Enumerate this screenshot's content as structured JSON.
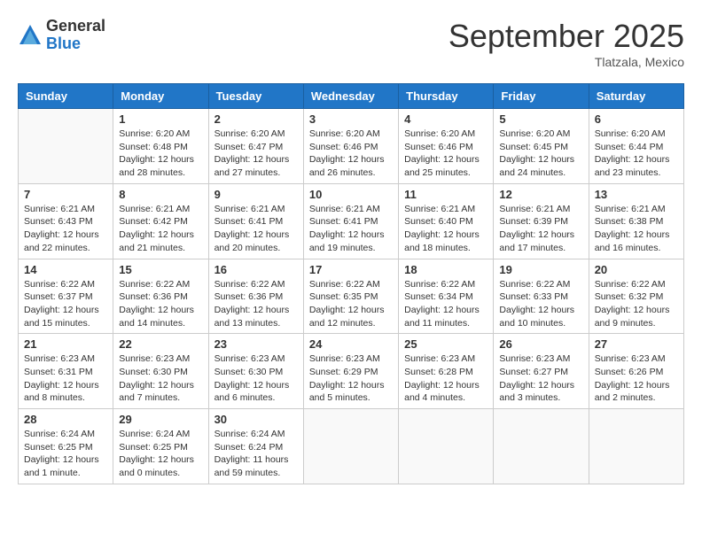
{
  "logo": {
    "general": "General",
    "blue": "Blue"
  },
  "header": {
    "month": "September 2025",
    "location": "Tlatzala, Mexico"
  },
  "weekdays": [
    "Sunday",
    "Monday",
    "Tuesday",
    "Wednesday",
    "Thursday",
    "Friday",
    "Saturday"
  ],
  "weeks": [
    [
      {
        "day": "",
        "info": ""
      },
      {
        "day": "1",
        "info": "Sunrise: 6:20 AM\nSunset: 6:48 PM\nDaylight: 12 hours\nand 28 minutes."
      },
      {
        "day": "2",
        "info": "Sunrise: 6:20 AM\nSunset: 6:47 PM\nDaylight: 12 hours\nand 27 minutes."
      },
      {
        "day": "3",
        "info": "Sunrise: 6:20 AM\nSunset: 6:46 PM\nDaylight: 12 hours\nand 26 minutes."
      },
      {
        "day": "4",
        "info": "Sunrise: 6:20 AM\nSunset: 6:46 PM\nDaylight: 12 hours\nand 25 minutes."
      },
      {
        "day": "5",
        "info": "Sunrise: 6:20 AM\nSunset: 6:45 PM\nDaylight: 12 hours\nand 24 minutes."
      },
      {
        "day": "6",
        "info": "Sunrise: 6:20 AM\nSunset: 6:44 PM\nDaylight: 12 hours\nand 23 minutes."
      }
    ],
    [
      {
        "day": "7",
        "info": "Sunrise: 6:21 AM\nSunset: 6:43 PM\nDaylight: 12 hours\nand 22 minutes."
      },
      {
        "day": "8",
        "info": "Sunrise: 6:21 AM\nSunset: 6:42 PM\nDaylight: 12 hours\nand 21 minutes."
      },
      {
        "day": "9",
        "info": "Sunrise: 6:21 AM\nSunset: 6:41 PM\nDaylight: 12 hours\nand 20 minutes."
      },
      {
        "day": "10",
        "info": "Sunrise: 6:21 AM\nSunset: 6:41 PM\nDaylight: 12 hours\nand 19 minutes."
      },
      {
        "day": "11",
        "info": "Sunrise: 6:21 AM\nSunset: 6:40 PM\nDaylight: 12 hours\nand 18 minutes."
      },
      {
        "day": "12",
        "info": "Sunrise: 6:21 AM\nSunset: 6:39 PM\nDaylight: 12 hours\nand 17 minutes."
      },
      {
        "day": "13",
        "info": "Sunrise: 6:21 AM\nSunset: 6:38 PM\nDaylight: 12 hours\nand 16 minutes."
      }
    ],
    [
      {
        "day": "14",
        "info": "Sunrise: 6:22 AM\nSunset: 6:37 PM\nDaylight: 12 hours\nand 15 minutes."
      },
      {
        "day": "15",
        "info": "Sunrise: 6:22 AM\nSunset: 6:36 PM\nDaylight: 12 hours\nand 14 minutes."
      },
      {
        "day": "16",
        "info": "Sunrise: 6:22 AM\nSunset: 6:36 PM\nDaylight: 12 hours\nand 13 minutes."
      },
      {
        "day": "17",
        "info": "Sunrise: 6:22 AM\nSunset: 6:35 PM\nDaylight: 12 hours\nand 12 minutes."
      },
      {
        "day": "18",
        "info": "Sunrise: 6:22 AM\nSunset: 6:34 PM\nDaylight: 12 hours\nand 11 minutes."
      },
      {
        "day": "19",
        "info": "Sunrise: 6:22 AM\nSunset: 6:33 PM\nDaylight: 12 hours\nand 10 minutes."
      },
      {
        "day": "20",
        "info": "Sunrise: 6:22 AM\nSunset: 6:32 PM\nDaylight: 12 hours\nand 9 minutes."
      }
    ],
    [
      {
        "day": "21",
        "info": "Sunrise: 6:23 AM\nSunset: 6:31 PM\nDaylight: 12 hours\nand 8 minutes."
      },
      {
        "day": "22",
        "info": "Sunrise: 6:23 AM\nSunset: 6:30 PM\nDaylight: 12 hours\nand 7 minutes."
      },
      {
        "day": "23",
        "info": "Sunrise: 6:23 AM\nSunset: 6:30 PM\nDaylight: 12 hours\nand 6 minutes."
      },
      {
        "day": "24",
        "info": "Sunrise: 6:23 AM\nSunset: 6:29 PM\nDaylight: 12 hours\nand 5 minutes."
      },
      {
        "day": "25",
        "info": "Sunrise: 6:23 AM\nSunset: 6:28 PM\nDaylight: 12 hours\nand 4 minutes."
      },
      {
        "day": "26",
        "info": "Sunrise: 6:23 AM\nSunset: 6:27 PM\nDaylight: 12 hours\nand 3 minutes."
      },
      {
        "day": "27",
        "info": "Sunrise: 6:23 AM\nSunset: 6:26 PM\nDaylight: 12 hours\nand 2 minutes."
      }
    ],
    [
      {
        "day": "28",
        "info": "Sunrise: 6:24 AM\nSunset: 6:25 PM\nDaylight: 12 hours\nand 1 minute."
      },
      {
        "day": "29",
        "info": "Sunrise: 6:24 AM\nSunset: 6:25 PM\nDaylight: 12 hours\nand 0 minutes."
      },
      {
        "day": "30",
        "info": "Sunrise: 6:24 AM\nSunset: 6:24 PM\nDaylight: 11 hours\nand 59 minutes."
      },
      {
        "day": "",
        "info": ""
      },
      {
        "day": "",
        "info": ""
      },
      {
        "day": "",
        "info": ""
      },
      {
        "day": "",
        "info": ""
      }
    ]
  ]
}
